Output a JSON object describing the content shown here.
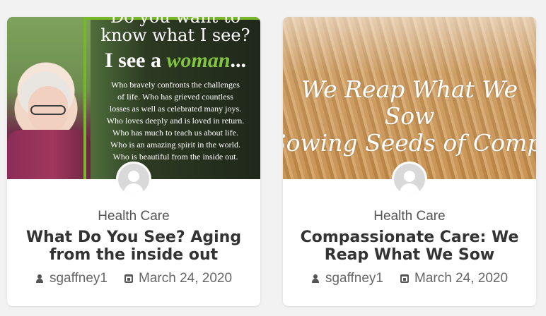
{
  "colors": {
    "page_bg": "#f2f2f2",
    "card_bg": "#ffffff",
    "accent_green": "#76b82a",
    "text_dark": "#333333",
    "text_meta": "#666666"
  },
  "cards": [
    {
      "image_text": {
        "line0": "Do you want to",
        "line1": "know what I see?",
        "big_lead": "I see a ",
        "big_green": "woman",
        "big_tail": "...",
        "body_lines": [
          "Who bravely confronts the challenges",
          "of life. Who has grieved countless",
          "losses as well as celebrated many joys.",
          "Who loves deeply and is loved in return.",
          "Who has much to teach us about life.",
          "Who is an amazing spirit in the world.",
          "Who is beautiful from the inside out."
        ]
      },
      "category": "Health Care",
      "title": "What Do You See? Aging from the inside out",
      "author": "sgaffney1",
      "date": "March 24, 2020"
    },
    {
      "image_text": {
        "line1": "We Reap What We Sow",
        "line2": "Sowing Seeds of Compassion"
      },
      "category": "Health Care",
      "title": "Compassionate Care: We Reap What We Sow",
      "author": "sgaffney1",
      "date": "March 24, 2020"
    }
  ]
}
